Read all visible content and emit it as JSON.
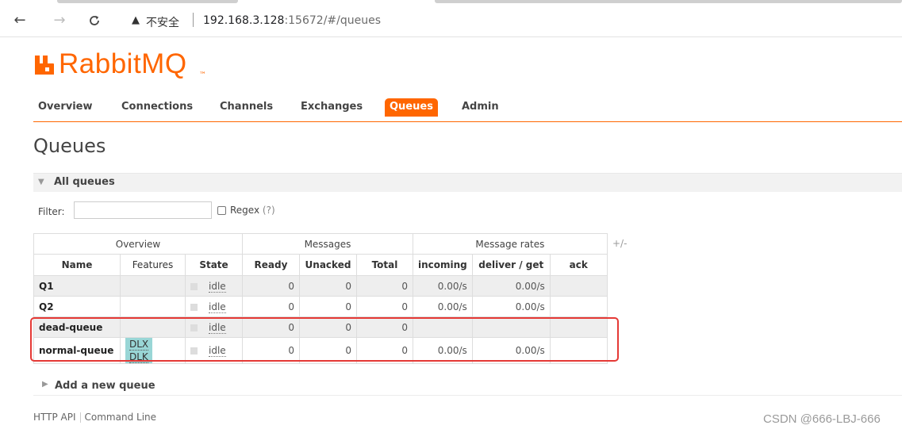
{
  "browser": {
    "back_icon": "arrow-left-icon",
    "forward_icon": "arrow-right-icon",
    "reload_icon": "reload-icon",
    "security_warning": "不安全",
    "url_host": "192.168.3.128",
    "url_rest": ":15672/#/queues"
  },
  "brand": {
    "logo_text": "RabbitMQ",
    "trademark": "™",
    "accent_color": "#ff6600"
  },
  "tabs": [
    "Overview",
    "Connections",
    "Channels",
    "Exchanges",
    "Queues",
    "Admin"
  ],
  "active_tab": "Queues",
  "page": {
    "title": "Queues"
  },
  "section": {
    "label": "All queues"
  },
  "filter": {
    "label": "Filter:",
    "value": "",
    "regex_label": "Regex",
    "regex_help": "(?)",
    "regex_checked": false
  },
  "table": {
    "groups": [
      "Overview",
      "Messages",
      "Message rates"
    ],
    "toggle_columns": "+/-",
    "columns": [
      "Name",
      "Features",
      "State",
      "Ready",
      "Unacked",
      "Total",
      "incoming",
      "deliver / get",
      "ack"
    ],
    "rows": [
      {
        "name": "Q1",
        "features": [],
        "state": "idle",
        "ready": "0",
        "unacked": "0",
        "total": "0",
        "incoming": "0.00/s",
        "deliver_get": "0.00/s",
        "ack": ""
      },
      {
        "name": "Q2",
        "features": [],
        "state": "idle",
        "ready": "0",
        "unacked": "0",
        "total": "0",
        "incoming": "0.00/s",
        "deliver_get": "0.00/s",
        "ack": ""
      },
      {
        "name": "dead-queue",
        "features": [],
        "state": "idle",
        "ready": "0",
        "unacked": "0",
        "total": "0",
        "incoming": "",
        "deliver_get": "",
        "ack": ""
      },
      {
        "name": "normal-queue",
        "features": [
          "DLX",
          "DLK"
        ],
        "state": "idle",
        "ready": "0",
        "unacked": "0",
        "total": "0",
        "incoming": "0.00/s",
        "deliver_get": "0.00/s",
        "ack": ""
      }
    ]
  },
  "add_queue": {
    "label": "Add a new queue"
  },
  "footer": {
    "links": [
      "HTTP API",
      "Command Line"
    ]
  },
  "watermark": "CSDN @666-LBJ-666",
  "colors": {
    "highlight": "#e53935",
    "feature_tag": "#99d6d6"
  }
}
